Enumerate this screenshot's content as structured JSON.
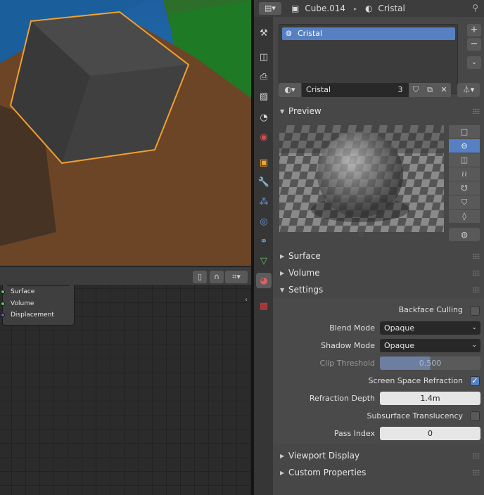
{
  "node_editor": {
    "node": {
      "sockets": [
        {
          "label": "Surface",
          "color": "#63c763"
        },
        {
          "label": "Volume",
          "color": "#63c763"
        },
        {
          "label": "Displacement",
          "color": "#6363c7"
        }
      ]
    }
  },
  "properties": {
    "header": {
      "object_name": "Cube.014",
      "material_name": "Cristal"
    },
    "slots": [
      {
        "label": "Cristal",
        "selected": true
      }
    ],
    "material_selector": {
      "name": "Cristal",
      "users": "3"
    },
    "panels": {
      "preview": "Preview",
      "surface": "Surface",
      "volume": "Volume",
      "settings": "Settings",
      "viewport_display": "Viewport Display",
      "custom_properties": "Custom Properties"
    },
    "settings": {
      "backface_culling": {
        "label": "Backface Culling",
        "checked": false
      },
      "blend_mode": {
        "label": "Blend Mode",
        "value": "Opaque"
      },
      "shadow_mode": {
        "label": "Shadow Mode",
        "value": "Opaque"
      },
      "clip_threshold": {
        "label": "Clip Threshold",
        "value": "0.500"
      },
      "ssr": {
        "label": "Screen Space Refraction",
        "checked": true
      },
      "refraction_depth": {
        "label": "Refraction Depth",
        "value": "1.4m"
      },
      "subsurface_translucency": {
        "label": "Subsurface Translucency",
        "checked": false
      },
      "pass_index": {
        "label": "Pass Index",
        "value": "0"
      }
    }
  },
  "colors": {
    "accent": "#5680c2",
    "selection_outline": "#f0a030"
  }
}
